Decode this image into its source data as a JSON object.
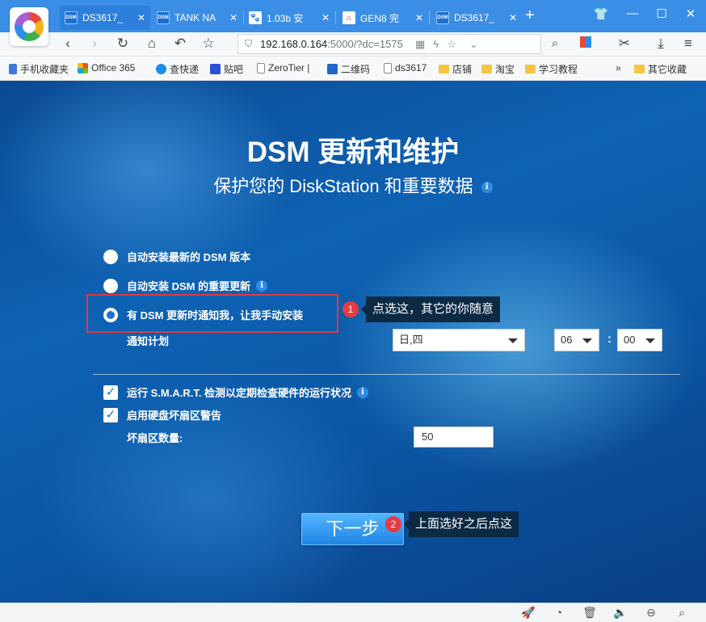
{
  "browser": {
    "tabs": [
      {
        "favicon": "DSM",
        "title": "DS3617_",
        "active": true
      },
      {
        "favicon": "DSM",
        "title": "TANK NA",
        "active": false
      },
      {
        "favicon": "paw-icon",
        "title": "1.03b 安",
        "active": false
      },
      {
        "favicon": "house-icon",
        "title": "GEN8 完",
        "active": false
      },
      {
        "favicon": "DSM",
        "title": "DS3617_",
        "active": false
      }
    ],
    "new_tab_label": "+",
    "url": {
      "host": "192.168.0.164",
      "rest": ":5000/?dc=1575"
    },
    "bookmarks": [
      {
        "icon": "phone-icon",
        "label": "手机收藏夹"
      },
      {
        "icon": "office-icon",
        "label": "Office 365"
      },
      {
        "icon": "express-icon",
        "label": "查快递"
      },
      {
        "icon": "paw-icon",
        "label": "贴吧"
      },
      {
        "icon": "doc-icon",
        "label": "ZeroTier |"
      },
      {
        "icon": "qr-icon",
        "label": "二维码"
      },
      {
        "icon": "doc-icon",
        "label": "ds3617"
      },
      {
        "icon": "folder-icon",
        "label": "店铺"
      },
      {
        "icon": "folder-icon",
        "label": "淘宝"
      },
      {
        "icon": "folder-icon",
        "label": "学习教程"
      }
    ],
    "bookmarks_more": "»",
    "other_bookmarks": "其它收藏"
  },
  "dsm": {
    "title": "DSM 更新和维护",
    "subtitle": "保护您的 DiskStation 和重要数据",
    "info_glyph": "i",
    "options": [
      {
        "label": "自动安装最新的 DSM 版本",
        "selected": false,
        "has_info": false
      },
      {
        "label": "自动安装 DSM 的重要更新",
        "selected": false,
        "has_info": true
      },
      {
        "label": "有 DSM 更新时通知我，让我手动安装",
        "selected": true,
        "has_info": false
      }
    ],
    "schedule": {
      "label": "通知计划",
      "days_value": "日,四",
      "hour_value": "06",
      "separator": ":",
      "minute_value": "00"
    },
    "smart_check": {
      "label": "运行 S.M.A.R.T. 检测以定期检查硬件的运行状况",
      "checked": true
    },
    "bad_sector_warning": {
      "label": "启用硬盘坏扇区警告",
      "checked": true
    },
    "bad_sector_count": {
      "label": "坏扇区数量:",
      "value": "50"
    },
    "next_button": "下一步"
  },
  "annotations": [
    {
      "number": "1",
      "text": "点选这，其它的你随意"
    },
    {
      "number": "2",
      "text": "上面选好之后点这"
    }
  ],
  "colors": {
    "chrome_blue": "#3a8ee6",
    "highlight_red": "#e0393e",
    "badge_red": "#e33c42",
    "callout_bg": "#0c2a44",
    "button_blue": "#1f86e6"
  }
}
